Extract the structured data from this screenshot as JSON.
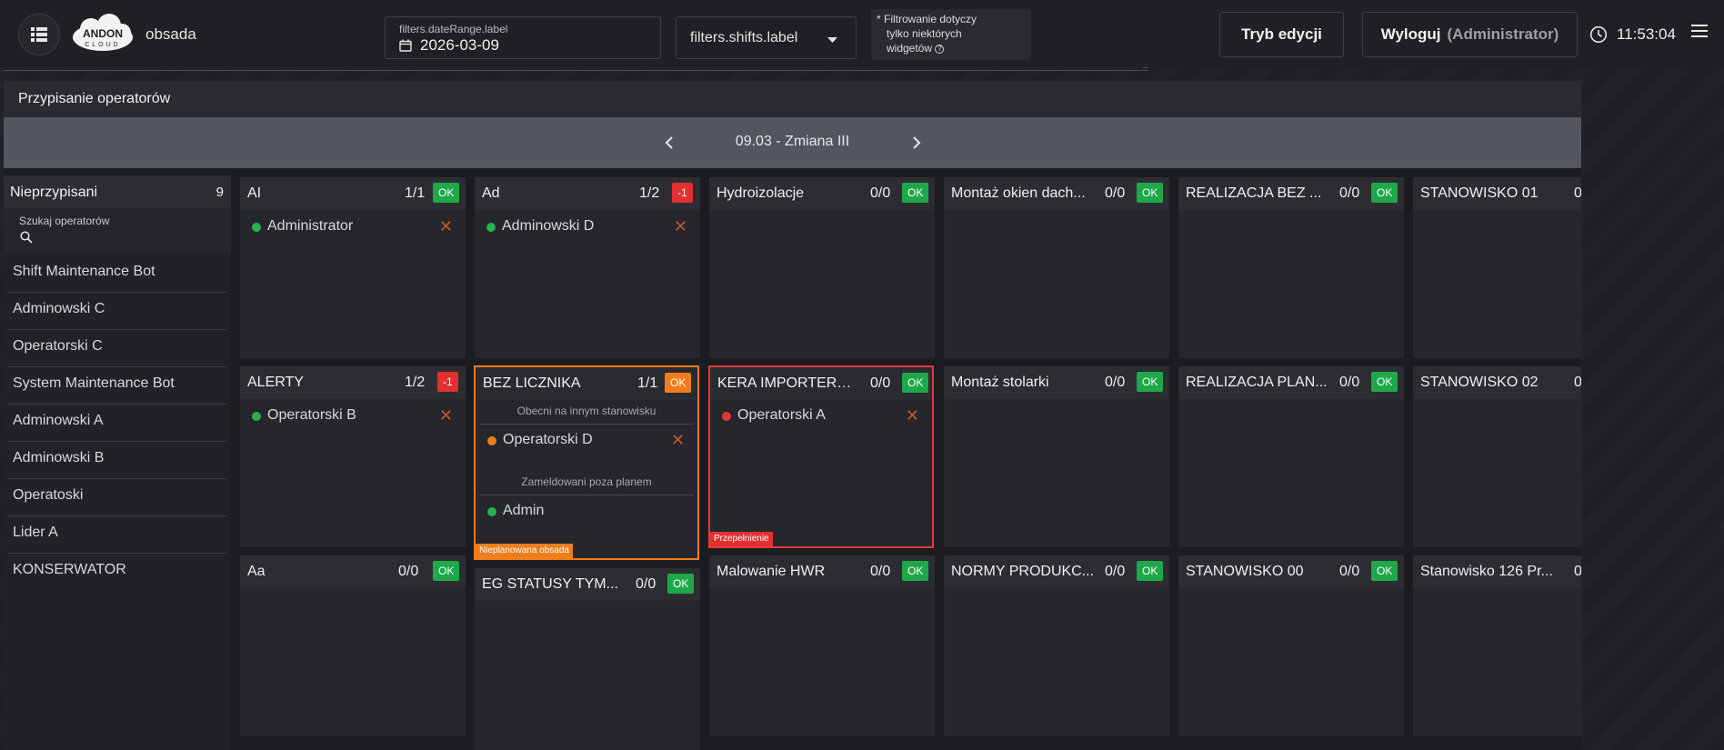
{
  "header": {
    "app_name": "obsada",
    "logo_text": "ANDON CLOUD",
    "date_label": "filters.dateRange.label",
    "date_value": "2026-03-09",
    "shifts_label": "filters.shifts.label",
    "filter_note": [
      "* Filtrowanie dotyczy",
      "tylko niektórych",
      "widgetów"
    ],
    "edit_button": "Tryb edycji",
    "logout_button": "Wyloguj",
    "logout_role": "(Administrator)",
    "time": "11:53:04"
  },
  "panel": {
    "title": "Przypisanie operatorów",
    "shift_label": "09.03 - Zmiana III"
  },
  "unassigned": {
    "title": "Nieprzypisani",
    "count": "9",
    "search_label": "Szukaj operatorów",
    "search_value": "",
    "operators": [
      "Shift Maintenance Bot",
      "Adminowski C",
      "Operatorski C",
      "System Maintenance Bot",
      "Adminowski A",
      "Adminowski B",
      "Operatoski",
      "Lider A",
      "KONSERWATOR"
    ]
  },
  "stations": {
    "ai": {
      "title": "AI",
      "count": "1/1",
      "badge": "OK",
      "operators": [
        "Administrator"
      ]
    },
    "ad": {
      "title": "Ad",
      "count": "1/2",
      "badge": "-1",
      "operators": [
        "Adminowski D"
      ]
    },
    "hydro": {
      "title": "Hydroizolacje",
      "count": "0/0",
      "badge": "OK"
    },
    "montaz_okien": {
      "title": "Montaż okien dach...",
      "count": "0/0",
      "badge": "OK"
    },
    "realizacja_bez": {
      "title": "REALIZACJA BEZ ...",
      "count": "0/0",
      "badge": "OK"
    },
    "stanowisko_01": {
      "title": "STANOWISKO 01",
      "count": "0"
    },
    "alerty": {
      "title": "ALERTY",
      "count": "1/2",
      "badge": "-1",
      "operators": [
        "Operatorski B"
      ]
    },
    "bez_licznika": {
      "title": "BEZ LICZNIKA",
      "count": "1/1",
      "badge": "OK",
      "section_other": "Obecni na innym stanowisku",
      "other_operators": [
        "Operatorski D"
      ],
      "section_unplanned": "Zameldowani poza planem",
      "unplanned_operators": [
        "Admin"
      ],
      "tag": "Nieplanowana obsada"
    },
    "kera": {
      "title": "KERA IMPORTER S...",
      "count": "0/0",
      "badge": "OK",
      "operators": [
        "Operatorski A"
      ],
      "tag": "Przepełnienie"
    },
    "montaz_stolarki": {
      "title": "Montaż stolarki",
      "count": "0/0",
      "badge": "OK"
    },
    "realizacja_plan": {
      "title": "REALIZACJA PLAN...",
      "count": "0/0",
      "badge": "OK"
    },
    "stanowisko_02": {
      "title": "STANOWISKO 02",
      "count": "0"
    },
    "aa": {
      "title": "Aa",
      "count": "0/0",
      "badge": "OK"
    },
    "eg_statusy": {
      "title": "EG STATUSY TYM...",
      "count": "0/0",
      "badge": "OK"
    },
    "malowanie": {
      "title": "Malowanie HWR",
      "count": "0/0",
      "badge": "OK"
    },
    "normy": {
      "title": "NORMY PRODUKC...",
      "count": "0/0",
      "badge": "OK"
    },
    "stanowisko_00": {
      "title": "STANOWISKO 00",
      "count": "0/0",
      "badge": "OK"
    },
    "stanowisko_126": {
      "title": "Stanowisko 126 Pr...",
      "count": "0"
    }
  },
  "colors": {
    "ok": "#1fa84a",
    "negative": "#e23030",
    "warning": "#ef7d1a",
    "present": "#25b24f"
  }
}
